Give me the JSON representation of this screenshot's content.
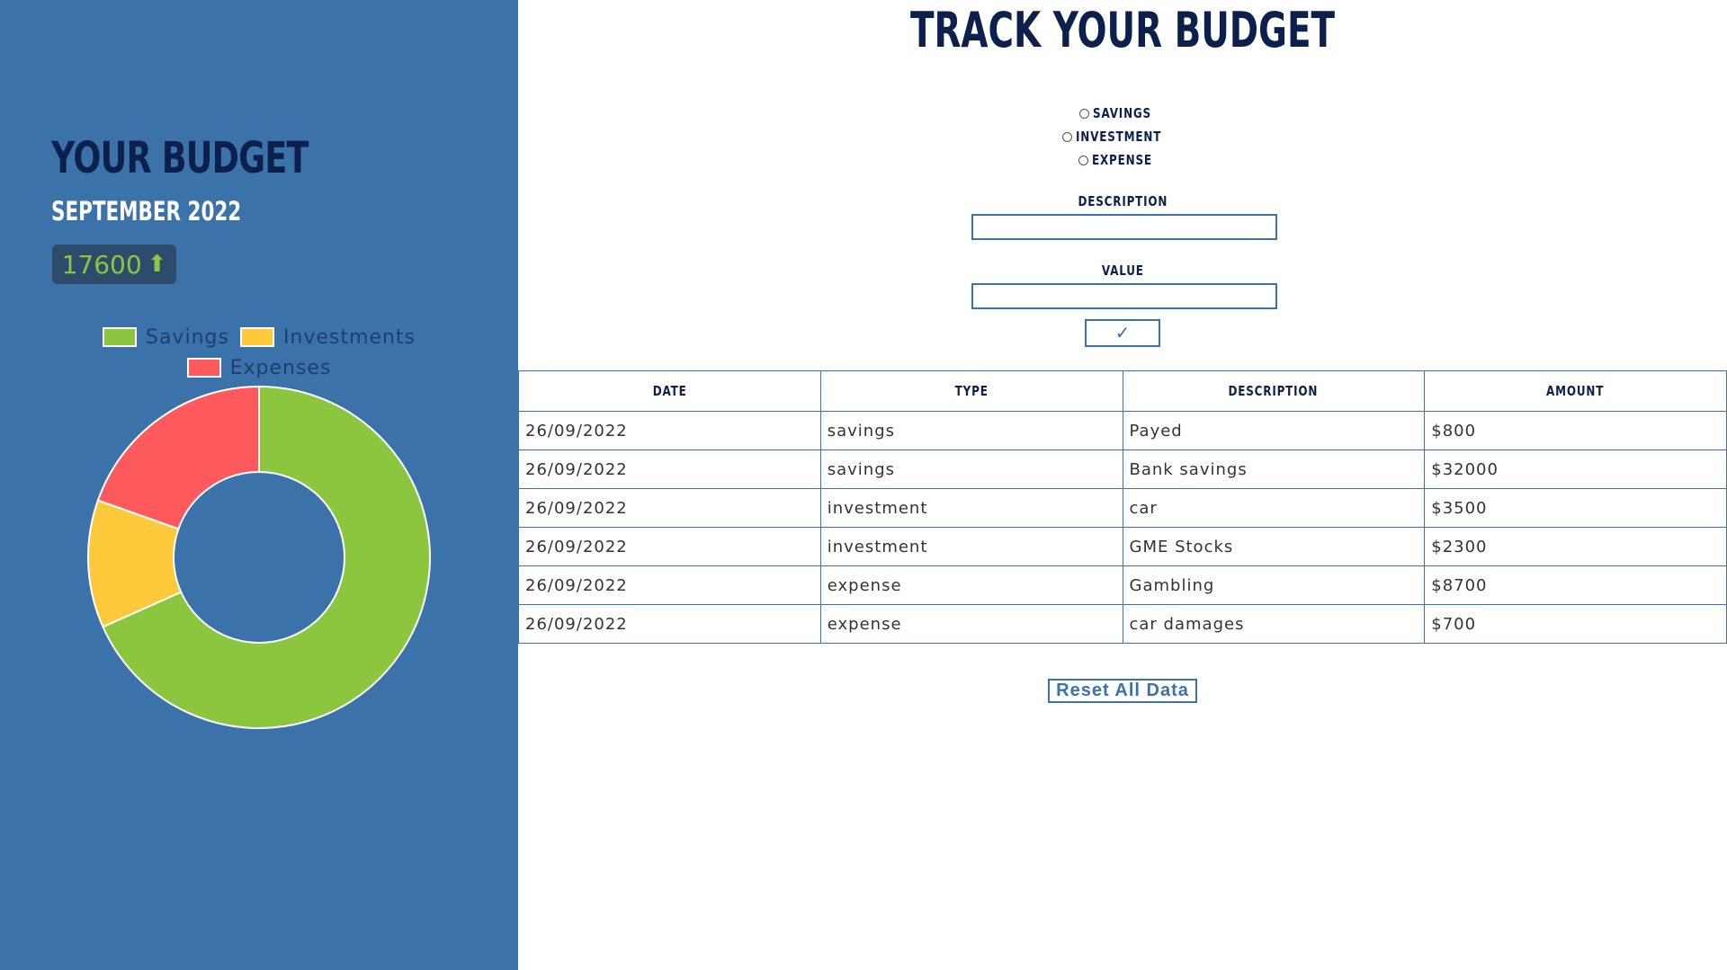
{
  "sidebar": {
    "title": "YOUR BUDGET",
    "month": "SEPTEMBER 2022",
    "balance": "17600",
    "balance_arrow": "⬆",
    "balance_color": "#8cc63f"
  },
  "chart_data": {
    "type": "pie",
    "donut": true,
    "categories": [
      "Savings",
      "Investments",
      "Expenses"
    ],
    "values": [
      32800,
      5800,
      9400
    ],
    "colors": [
      "#8cc63f",
      "#ffc93c",
      "#fe5a5e"
    ],
    "legend_position": "top"
  },
  "main": {
    "title": "TRACK YOUR BUDGET",
    "radios": [
      {
        "label": "SAVINGS"
      },
      {
        "label": "INVESTMENT"
      },
      {
        "label": "EXPENSE"
      }
    ],
    "description_label": "DESCRIPTION",
    "description_value": "",
    "value_label": "VALUE",
    "value_value": "",
    "submit_label": "✓",
    "reset_label": "Reset All Data"
  },
  "table": {
    "headers": [
      "DATE",
      "TYPE",
      "DESCRIPTION",
      "AMOUNT"
    ],
    "rows": [
      [
        "26/09/2022",
        "savings",
        "Payed",
        "$800"
      ],
      [
        "26/09/2022",
        "savings",
        "Bank savings",
        "$32000"
      ],
      [
        "26/09/2022",
        "investment",
        "car",
        "$3500"
      ],
      [
        "26/09/2022",
        "investment",
        "GME Stocks",
        "$2300"
      ],
      [
        "26/09/2022",
        "expense",
        "Gambling",
        "$8700"
      ],
      [
        "26/09/2022",
        "expense",
        "car damages",
        "$700"
      ]
    ]
  },
  "colors": {
    "sidebar_bg": "#3b72aa",
    "title_navy": "#0d1f4c",
    "accent_blue": "#3b72aa"
  }
}
